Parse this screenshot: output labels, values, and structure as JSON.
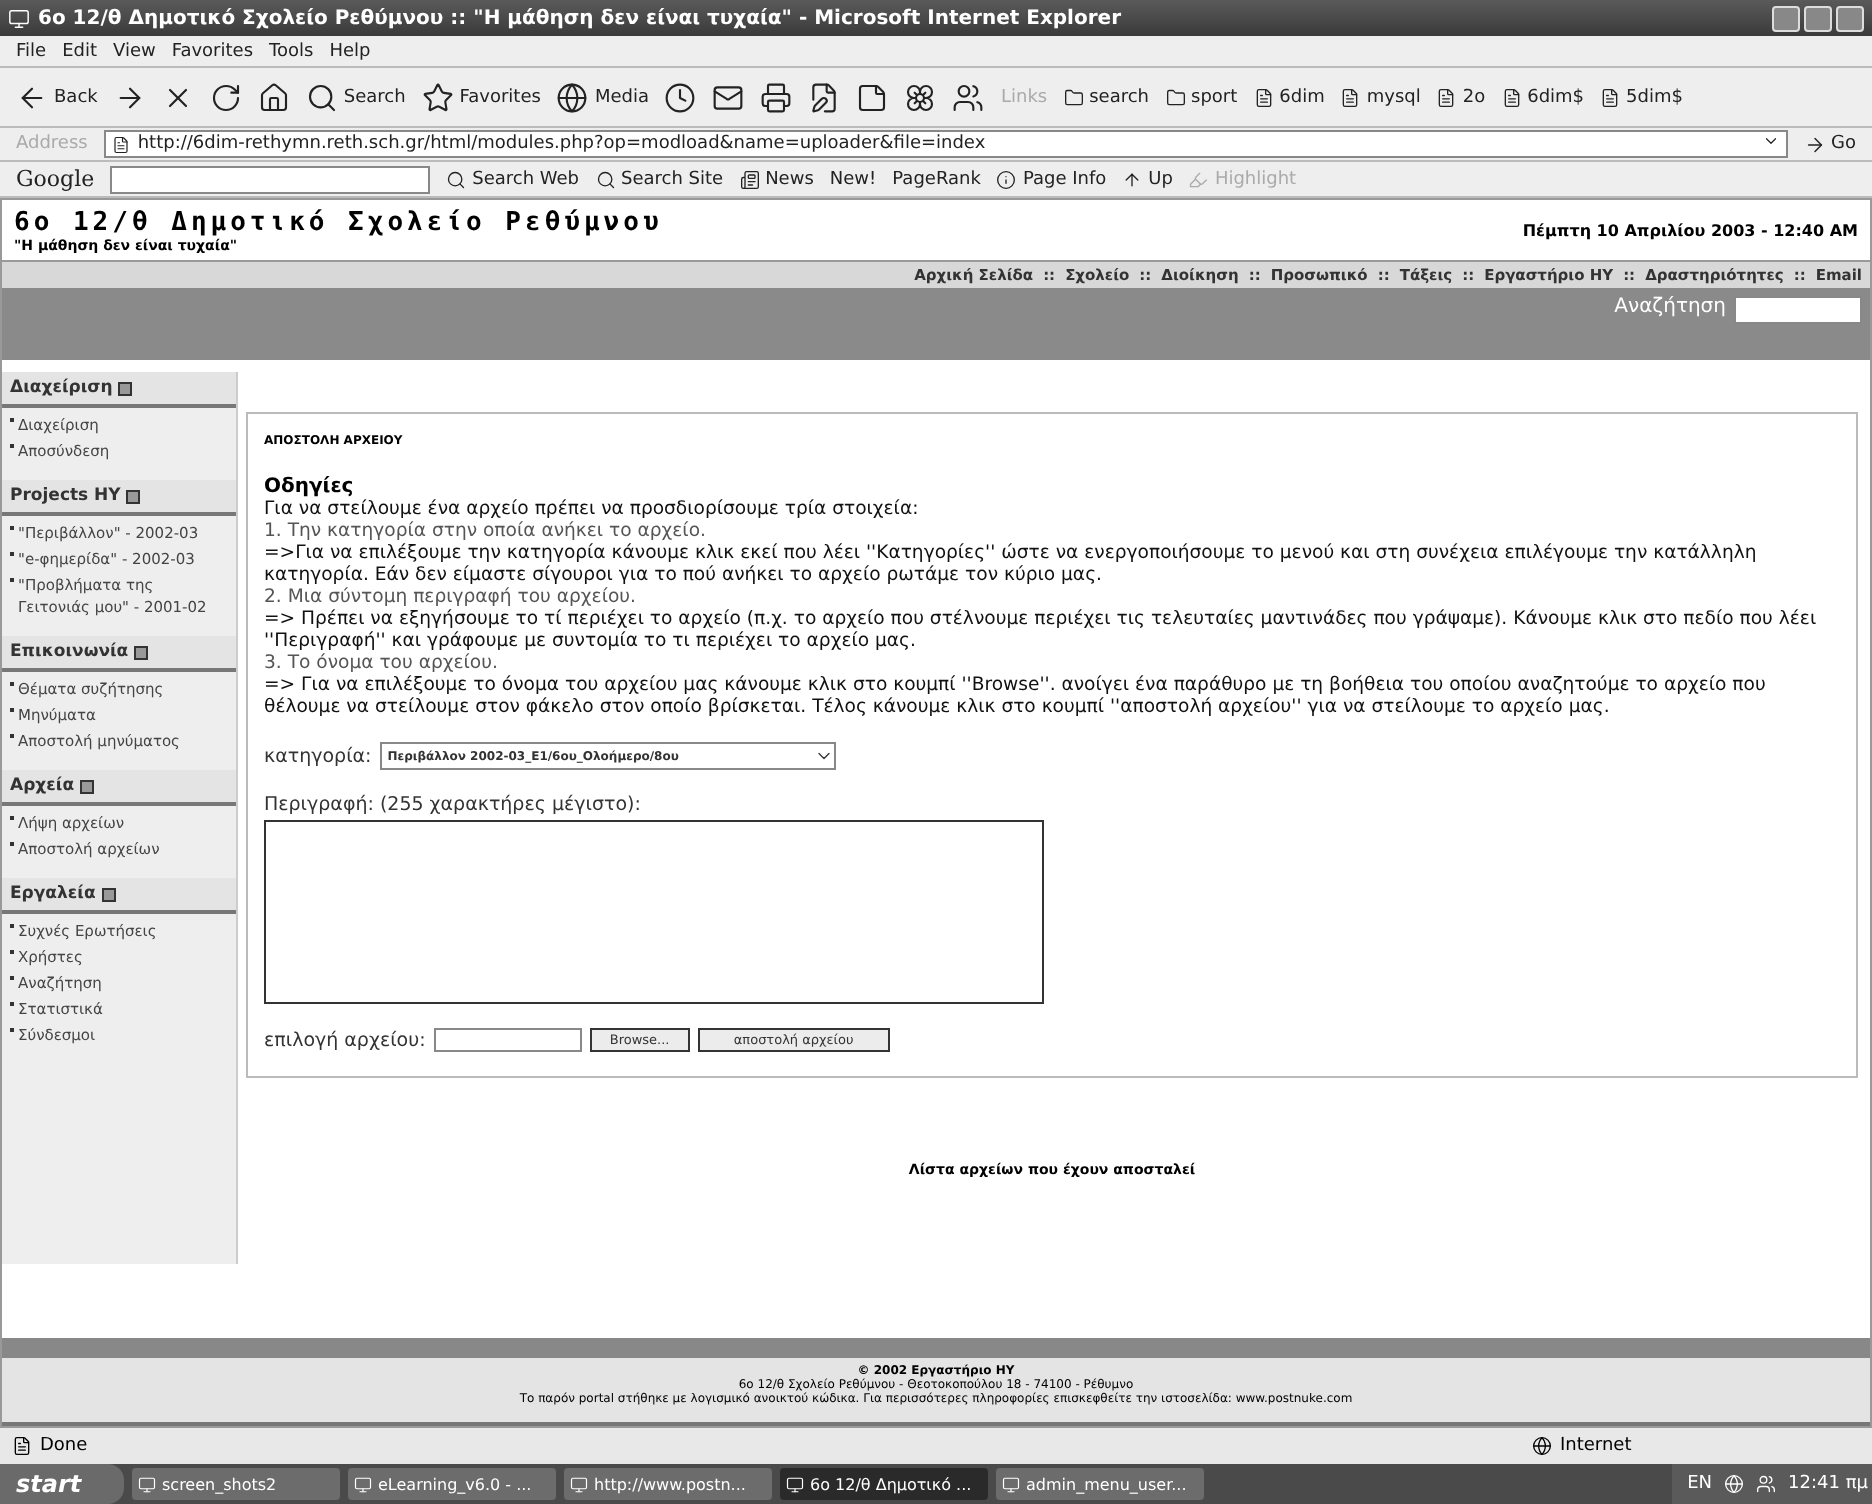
{
  "window": {
    "title": "6ο 12/θ Δημοτικό Σχολείο Ρεθύμνου :: \"Η μάθηση δεν είναι τυχαία\" - Microsoft Internet Explorer"
  },
  "menu": [
    "File",
    "Edit",
    "View",
    "Favorites",
    "Tools",
    "Help"
  ],
  "toolbar": [
    {
      "kind": "back",
      "label": "Back"
    },
    {
      "kind": "forward"
    },
    {
      "kind": "stop"
    },
    {
      "kind": "refresh"
    },
    {
      "kind": "home"
    },
    {
      "kind": "search",
      "label": "Search"
    },
    {
      "kind": "favorites",
      "label": "Favorites"
    },
    {
      "kind": "media",
      "label": "Media"
    },
    {
      "kind": "history"
    },
    {
      "kind": "mail"
    },
    {
      "kind": "print"
    },
    {
      "kind": "edit"
    },
    {
      "kind": "note"
    },
    {
      "kind": "flower"
    },
    {
      "kind": "people"
    }
  ],
  "links": {
    "label": "Links",
    "items": [
      {
        "kind": "folder",
        "label": "search"
      },
      {
        "kind": "folder",
        "label": "sport"
      },
      {
        "kind": "page",
        "label": "6dim"
      },
      {
        "kind": "page",
        "label": "mysql"
      },
      {
        "kind": "page",
        "label": "2o"
      },
      {
        "kind": "page",
        "label": "6dim$"
      },
      {
        "kind": "page",
        "label": "5dim$"
      }
    ]
  },
  "address": {
    "label": "Address",
    "url": "http://6dim-rethymn.reth.sch.gr/html/modules.php?op=modload&name=uploader&file=index",
    "go": "Go"
  },
  "google": {
    "logo": "Google",
    "items": [
      {
        "kind": "search",
        "label": "Search Web",
        "disabled": false
      },
      {
        "kind": "site",
        "label": "Search Site",
        "disabled": false
      },
      {
        "kind": "news",
        "label": "News",
        "disabled": false
      },
      {
        "kind": "new",
        "label": "New!",
        "disabled": false
      },
      {
        "kind": "rank",
        "label": "PageRank",
        "disabled": false
      },
      {
        "kind": "info",
        "label": "Page Info",
        "disabled": false
      },
      {
        "kind": "up",
        "label": "Up",
        "disabled": false
      },
      {
        "kind": "highlight",
        "label": "Highlight",
        "disabled": true
      }
    ]
  },
  "site": {
    "title": "6ο 12/θ Δημοτικό Σχολείο Ρεθύμνου",
    "motto": "\"Η μάθηση δεν είναι τυχαία\"",
    "date": "Πέμπτη 10 Απριλίου 2003 - 12:40 AM",
    "nav": [
      "Αρχική Σελίδα",
      "Σχολείο",
      "Διοίκηση",
      "Προσωπικό",
      "Τάξεις",
      "Εργαστήριο ΗΥ",
      "Δραστηριότητες",
      "Email"
    ],
    "separator": "::",
    "search_label": "Αναζήτηση"
  },
  "sidebar": [
    {
      "title": "Διαχείριση",
      "items": [
        "Διαχείριση",
        "Αποσύνδεση"
      ]
    },
    {
      "title": "Projects HY",
      "items": [
        "\"Περιβάλλον\" - 2002-03",
        "\"e-φημερίδα\" - 2002-03",
        "\"Προβλήματα της Γειτονιάς μου\" - 2001-02"
      ]
    },
    {
      "title": "Επικοινωνία",
      "items": [
        "Θέματα συζήτησης",
        "Μηνύματα",
        "Αποστολή μηνύματος"
      ]
    },
    {
      "title": "Αρχεία",
      "items": [
        "Λήψη αρχείων",
        "Αποστολή αρχείων"
      ]
    },
    {
      "title": "Εργαλεία",
      "items": [
        "Συχνές Ερωτήσεις",
        "Χρήστες",
        "Αναζήτηση",
        "Στατιστικά",
        "Σύνδεσμοι"
      ]
    }
  ],
  "content": {
    "heading": "ΑΠΟΣΤΟΛΗ ΑΡΧΕΙΟΥ",
    "instructions_title": "Οδηγίες",
    "lines": [
      {
        "kind": "detail",
        "text": "Για να στείλουμε ένα αρχείο πρέπει να προσδιορίσουμε τρία στοιχεία:"
      },
      {
        "kind": "step",
        "text": "1. Την κατηγορία στην οποία ανήκει το αρχείο."
      },
      {
        "kind": "detail",
        "text": "=>Για να επιλέξουμε την κατηγορία κάνουμε κλικ εκεί που λέει ''Κατηγορίες'' ώστε να ενεργοποιήσουμε το μενού και στη συνέχεια επιλέγουμε την κατάλληλη κατηγορία. Εάν δεν είμαστε σίγουροι για το πού ανήκει το αρχείο ρωτάμε τον κύριο μας."
      },
      {
        "kind": "step",
        "text": "2. Μια σύντομη περιγραφή του αρχείου."
      },
      {
        "kind": "detail",
        "text": "=> Πρέπει να εξηγήσουμε το τί περιέχει το αρχείο (π.χ. το αρχείο που στέλνουμε περιέχει τις τελευταίες μαντινάδες που γράψαμε). Κάνουμε κλικ στο πεδίο που λέει ''Περιγραφή'' και γράφουμε με συντομία το τι περιέχει το αρχείο μας."
      },
      {
        "kind": "step",
        "text": "3. Το όνομα του αρχείου."
      },
      {
        "kind": "detail",
        "text": "=> Για να επιλέξουμε το όνομα του αρχείου μας κάνουμε κλικ στο κουμπί ''Browse''. ανοίγει ένα παράθυρο με τη βοήθεια του οποίου αναζητούμε το αρχείο που θέλουμε να στείλουμε στον φάκελο στον οποίο βρίσκεται. Τέλος κάνουμε κλικ στο κουμπί ''αποστολή αρχείου'' για να στείλουμε το αρχείο μας."
      }
    ],
    "category_label": "κατηγορία:",
    "category_value": "Περιβάλλον 2002-03_Ε1/6ου_Ολοήμερο/8ου",
    "description_label": "Περιγραφή: (255 χαρακτήρες μέγιστο):",
    "file_label": "επιλογή αρχείου:",
    "browse": "Browse...",
    "submit": "αποστολή αρχείου",
    "list_link": "Λίστα αρχείων που έχουν αποσταλεί"
  },
  "footer": [
    "© 2002 Εργαστήριο ΗΥ",
    "6ο 12/θ Σχολείο Ρεθύμνου - Θεοτοκοπούλου 18 - 74100 - Ρέθυμνο",
    "Το παρόν portal στήθηκε με λογισμικό ανοικτού κώδικα. Για περισσότερες πληροφορίες επισκεφθείτε την ιστοσελίδα: www.postnuke.com"
  ],
  "status": {
    "text": "Done",
    "zone": "Internet"
  },
  "taskbar": {
    "start": "start",
    "tasks": [
      {
        "label": "screen_shots2",
        "selected": false
      },
      {
        "label": "eLearning_v6.0 - ...",
        "selected": false
      },
      {
        "label": "http://www.postn...",
        "selected": false
      },
      {
        "label": "6ο 12/θ Δημοτικό ...",
        "selected": true
      },
      {
        "label": "admin_menu_user...",
        "selected": false
      }
    ],
    "lang": "EN",
    "clock": "12:41 πμ"
  }
}
